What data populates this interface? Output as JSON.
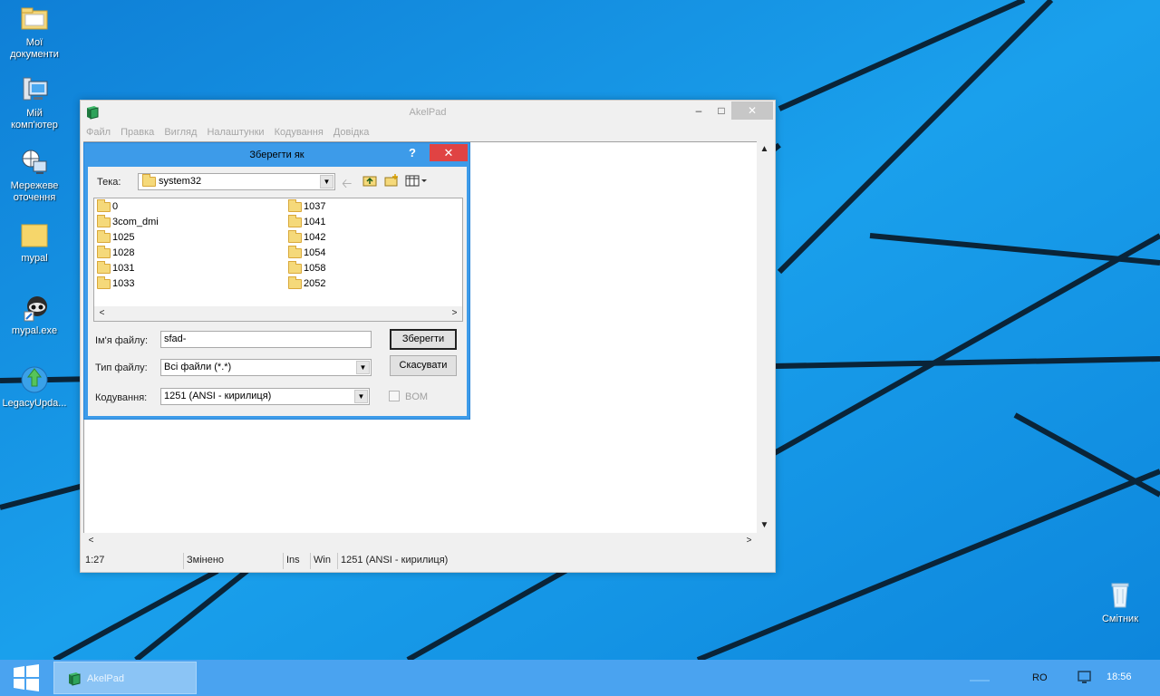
{
  "desktop": {
    "icons": [
      {
        "label": "Мої\nдокументи",
        "icon": "documents-folder-icon"
      },
      {
        "label": "Мій\nкомп'ютер",
        "icon": "computer-icon"
      },
      {
        "label": "Мережеве\nоточення",
        "icon": "network-icon"
      },
      {
        "label": "mypal",
        "icon": "folder-icon"
      },
      {
        "label": "mypal.exe",
        "icon": "raccoon-app-icon"
      },
      {
        "label": "LegacyUpda...",
        "icon": "update-globe-icon"
      }
    ],
    "recycle_bin": {
      "label": "Смітник",
      "icon": "recycle-bin-icon"
    }
  },
  "window": {
    "title": "AkelPad",
    "menu": [
      "Файл",
      "Правка",
      "Вигляд",
      "Налаштунки",
      "Кодування",
      "Довідка"
    ],
    "minimize": "–",
    "maximize": "□",
    "close": "✕",
    "statusbar": {
      "position": "1:27",
      "modified": "Змінено",
      "insert": "Ins",
      "newline": "Win",
      "encoding": "1251  (ANSI - кирилиця)"
    }
  },
  "dialog": {
    "title": "Зберегти як",
    "help": "?",
    "close": "✕",
    "folder_label": "Тека:",
    "folder_value": "system32",
    "files_col1": [
      "0",
      "3com_dmi",
      "1025",
      "1028",
      "1031",
      "1033"
    ],
    "files_col2": [
      "1037",
      "1041",
      "1042",
      "1054",
      "1058",
      "2052"
    ],
    "filename_label": "Ім'я файлу:",
    "filename_value": "sfad-",
    "filetype_label": "Тип файлу:",
    "filetype_value": "Всі файли (*.*)",
    "encoding_label": "Кодування:",
    "encoding_value": "1251  (ANSI - кирилиця)",
    "save_button": "Зберегти",
    "cancel_button": "Скасувати",
    "bom_label": "BOM"
  },
  "taskbar": {
    "app_label": "AkelPad",
    "language": "RO",
    "clock": "18:56"
  },
  "colors": {
    "desktop": "#1596e6",
    "dialog_frame": "#3d9be9",
    "close_red": "#e04343",
    "taskbar": "#4aa3f0"
  }
}
